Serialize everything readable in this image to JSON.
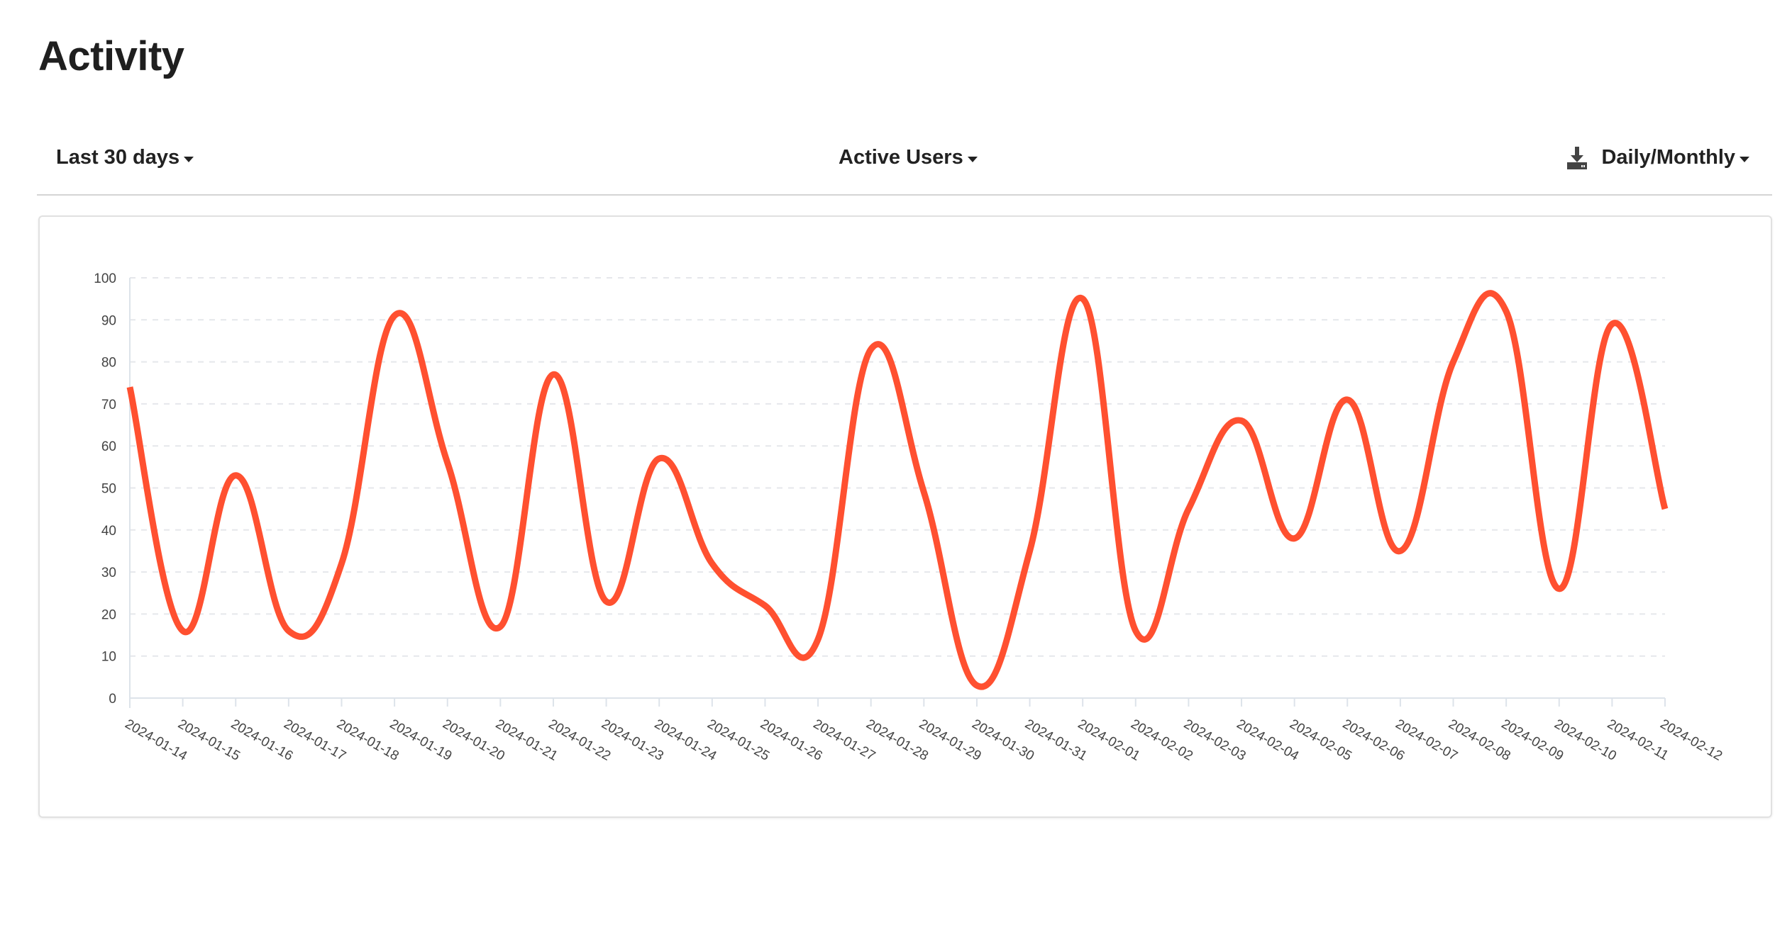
{
  "page": {
    "title": "Activity"
  },
  "toolbar": {
    "range_label": "Last 30 days",
    "metric_label": "Active Users",
    "granularity_label": "Daily/Monthly",
    "download_icon": "download-icon"
  },
  "colors": {
    "line": "#ff5030",
    "grid": "#e5e7eb",
    "axis": "#dde3ea"
  },
  "chart_data": {
    "type": "line",
    "title": "",
    "xlabel": "",
    "ylabel": "",
    "ylim": [
      0,
      100
    ],
    "yticks": [
      "0",
      "10",
      "20",
      "30",
      "40",
      "50",
      "60",
      "70",
      "80",
      "90",
      "100"
    ],
    "grid": true,
    "smooth": true,
    "categories": [
      "2024-01-14",
      "2024-01-15",
      "2024-01-16",
      "2024-01-17",
      "2024-01-18",
      "2024-01-19",
      "2024-01-20",
      "2024-01-21",
      "2024-01-22",
      "2024-01-23",
      "2024-01-24",
      "2024-01-25",
      "2024-01-26",
      "2024-01-27",
      "2024-01-28",
      "2024-01-29",
      "2024-01-30",
      "2024-01-31",
      "2024-02-01",
      "2024-02-02",
      "2024-02-03",
      "2024-02-04",
      "2024-02-05",
      "2024-02-06",
      "2024-02-07",
      "2024-02-08",
      "2024-02-09",
      "2024-02-10",
      "2024-02-11",
      "2024-02-12"
    ],
    "series": [
      {
        "values": [
          74,
          16,
          53,
          16,
          32,
          91,
          56,
          17,
          77,
          23,
          57,
          32,
          22,
          14,
          83,
          49,
          3,
          35,
          95,
          16,
          45,
          66,
          38,
          71,
          35,
          80,
          92,
          26,
          89,
          45
        ]
      }
    ]
  }
}
